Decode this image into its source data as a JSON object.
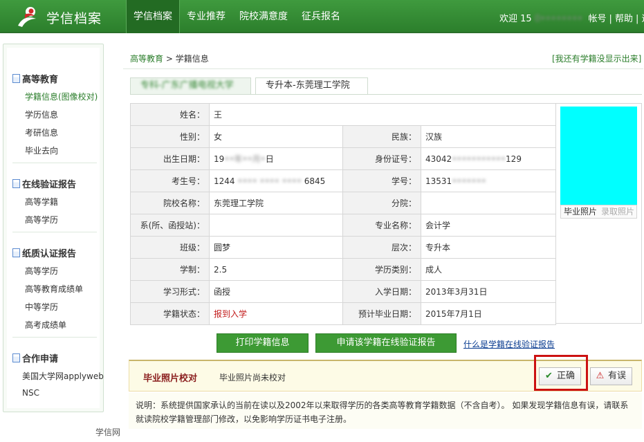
{
  "header": {
    "logo_text": "学信档案",
    "nav": [
      "学信档案",
      "专业推荐",
      "院校满意度",
      "征兵报名"
    ],
    "welcome_prefix": "欢迎 15",
    "welcome_masked": "0••••••••",
    "account": "帐号",
    "help": "帮助",
    "logout": "退"
  },
  "sidebar": {
    "sections": [
      {
        "title": "高等教育",
        "items": [
          "学籍信息(图像校对)",
          "学历信息",
          "考研信息",
          "毕业去向"
        ]
      },
      {
        "title": "在线验证报告",
        "items": [
          "高等学籍",
          "高等学历"
        ]
      },
      {
        "title": "纸质认证报告",
        "items": [
          "高等学历",
          "高等教育成绩单",
          "中等学历",
          "高考成绩单"
        ]
      },
      {
        "title": "合作申请",
        "items": [
          "美国大学网applyweb",
          "NSC"
        ]
      }
    ]
  },
  "breadcrumb": {
    "link": "高等教育",
    "sep": ">",
    "current": "学籍信息"
  },
  "missing_link": "[我还有学籍没显示出来]",
  "tabs": {
    "inactive": "专科-广东广播电视大学",
    "active": "专升本-东莞理工学院"
  },
  "record": {
    "name_label": "姓名：",
    "name_value": "王",
    "gender_label": "性别：",
    "gender_value": "女",
    "ethnicity_label": "民族：",
    "ethnicity_value": "汉族",
    "birth_label": "出生日期：",
    "birth_value_a": "19",
    "birth_value_mask": "••年••月•",
    "birth_value_b": "日",
    "id_label": "身份证号：",
    "id_value_a": "43042",
    "id_value_mask": "•••••••••••",
    "id_value_b": "129",
    "exam_no_label": "考生号：",
    "exam_no_a": "1244",
    "exam_no_mask": "•••• •••• ••••",
    "exam_no_b": "6845",
    "student_no_label": "学号：",
    "student_no_a": "13531",
    "student_no_mask": "•••••••",
    "school_label": "院校名称：",
    "school_value": "东莞理工学院",
    "branch_label": "分院：",
    "branch_value": "",
    "dept_label": "系(所、函授站)：",
    "dept_value": "",
    "major_label": "专业名称：",
    "major_value": "会计学",
    "class_label": "班级：",
    "class_value": "圆梦",
    "level_label": "层次：",
    "level_value": "专升本",
    "duration_label": "学制：",
    "duration_value": "2.5",
    "category_label": "学历类别：",
    "category_value": "成人",
    "form_label": "学习形式：",
    "form_value": "函授",
    "enroll_label": "入学日期：",
    "enroll_value": "2013年3月31日",
    "status_label": "学籍状态：",
    "status_value": "报到入学",
    "grad_label": "预计毕业日期：",
    "grad_value": "2015年7月1日"
  },
  "photo": {
    "label": "毕业照片",
    "capture": "录取照片"
  },
  "actions": {
    "print": "打印学籍信息",
    "apply": "申请该学籍在线验证报告",
    "what": "什么是学籍在线验证报告"
  },
  "check": {
    "title": "毕业照片校对",
    "status": "毕业照片尚未校对",
    "correct": "正确",
    "wrong": "有误"
  },
  "note": "说明：系统提供国家承认的当前在读以及2002年以来取得学历的各类高等教育学籍数据（不含自考）。 如果发现学籍信息有误，请联系就读院校学籍管理部门修改，以免影响学历证书电子注册。",
  "footer": "学信网",
  "colors": {
    "brand_green": "#3f9a3e",
    "status_red": "#c21b1b",
    "photo_cyan": "#00ffff",
    "highlight_red": "#cc1111"
  }
}
